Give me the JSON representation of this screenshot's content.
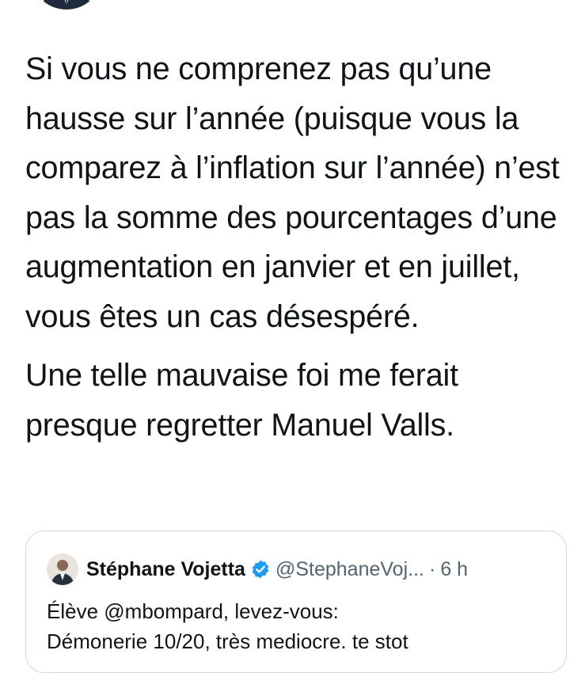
{
  "tweet": {
    "paragraphs": [
      "Si vous ne comprenez pas qu’une hausse sur l’année (puisque vous la comparez à l’inflation sur l’année) n’est pas la somme des pourcentages d’une augmentation en janvier et en juillet, vous êtes un cas désespéré.",
      "Une telle mauvaise foi me ferait presque regretter Manuel Valls."
    ]
  },
  "quoted_tweet": {
    "author_name": "Stéphane Vojetta",
    "handle": "@StephaneVoj...",
    "separator": "·",
    "time": "6 h",
    "text_lines": [
      "Élève @mbompard, levez-vous:",
      "Démonerie 10/20, très mediocre. te stot"
    ]
  },
  "icons": {
    "verified": "verified-badge-icon",
    "verified_color": "#1d9bf0"
  }
}
